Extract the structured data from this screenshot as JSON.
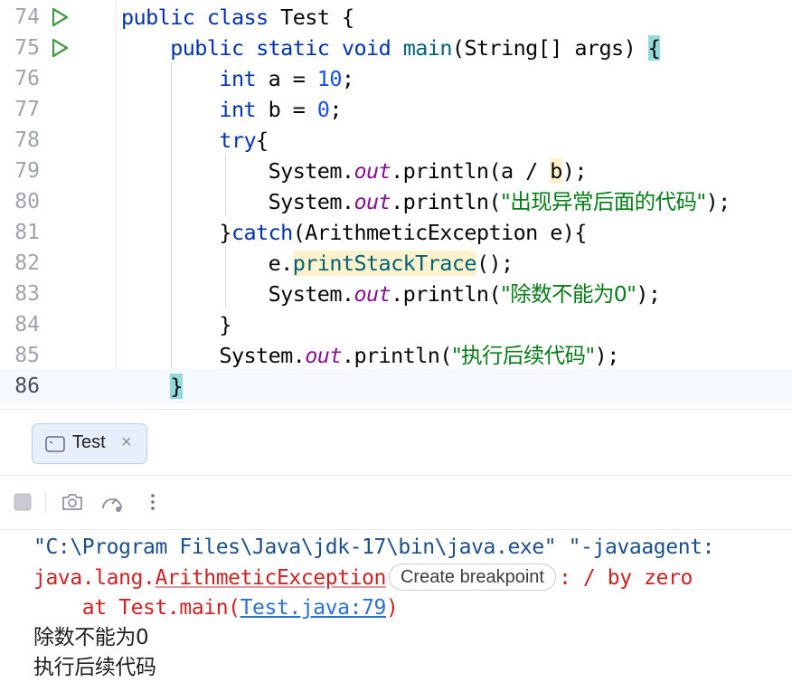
{
  "editor": {
    "lines": [
      {
        "no": "74",
        "has_run": true
      },
      {
        "no": "75",
        "has_run": true
      },
      {
        "no": "76"
      },
      {
        "no": "77"
      },
      {
        "no": "78"
      },
      {
        "no": "79"
      },
      {
        "no": "80"
      },
      {
        "no": "81"
      },
      {
        "no": "82"
      },
      {
        "no": "83"
      },
      {
        "no": "84"
      },
      {
        "no": "85"
      },
      {
        "no": "86",
        "current": true
      }
    ],
    "tokens": {
      "l74": {
        "kw1": "public",
        "kw2": "class",
        "name": "Test",
        "brace": "{"
      },
      "l75": {
        "kw1": "public",
        "kw2": "static",
        "kw3": "void",
        "fn": "main",
        "params": "(String[] args) ",
        "brace": "{"
      },
      "l76": {
        "kw": "int",
        "text": " a = ",
        "num": "10",
        "end": ";"
      },
      "l77": {
        "kw": "int",
        "text": " b = ",
        "num": "0",
        "end": ";"
      },
      "l78": {
        "kw": "try",
        "brace": "{"
      },
      "l79": {
        "sys": "System.",
        "fld": "out",
        "call": ".println(a / ",
        "arg": "b",
        "end": ");"
      },
      "l80": {
        "sys": "System.",
        "fld": "out",
        "call": ".println(",
        "str": "\"出现异常后面的代码\"",
        "end": ");"
      },
      "l81": {
        "open": "}",
        "kw": "catch",
        "text": "(ArithmeticException e){"
      },
      "l82": {
        "pre": "e.",
        "fn": "printStackTrace",
        "end": "();"
      },
      "l83": {
        "sys": "System.",
        "fld": "out",
        "call": ".println(",
        "str": "\"除数不能为0\"",
        "end": ");"
      },
      "l84": {
        "brace": "}"
      },
      "l85": {
        "sys": "System.",
        "fld": "out",
        "call": ".println(",
        "str": "\"执行后续代码\"",
        "end": ");"
      },
      "l86": {
        "brace": "}"
      }
    }
  },
  "run_window": {
    "tab": {
      "label": "Test",
      "close": "×"
    },
    "toolbar": [
      "stop-icon",
      "camera-icon",
      "gauge-icon",
      "more-vertical-icon"
    ],
    "console": {
      "cmd": "\"C:\\Program Files\\Java\\jdk-17\\bin\\java.exe\" \"-javaagent:",
      "exc_pkg": "java.lang.",
      "exc_name": "ArithmeticException",
      "breakpoint_chip": "Create breakpoint",
      "exc_msg": ": / by zero",
      "at_prefix": "    at Test.main(",
      "at_link": "Test.java:79",
      "at_suffix": ")",
      "out1": "除数不能为0",
      "out2": "执行后续代码"
    }
  },
  "colors": {
    "keyword": "#0033b3",
    "number": "#1750eb",
    "string": "#067d17",
    "field": "#871094",
    "method": "#00627a",
    "error": "#cf2020",
    "link": "#2e6fd6"
  }
}
